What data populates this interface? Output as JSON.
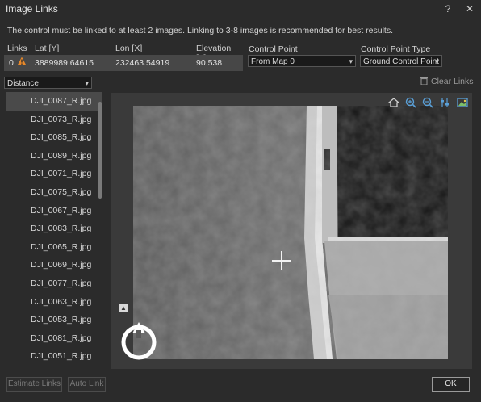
{
  "window": {
    "title": "Image Links"
  },
  "info_text": "The control must be linked to at least 2 images. Linking to 3-8 images is recommended for best results.",
  "links_table": {
    "headers": {
      "links": "Links",
      "lat": "Lat [Y]",
      "lon": "Lon [X]",
      "elev": "Elevation [Z]"
    },
    "row": {
      "links": "0",
      "lat": "3889989.64615",
      "lon": "232463.54919",
      "elev": "90.538"
    }
  },
  "control_point": {
    "label": "Control Point",
    "value": "From Map 0"
  },
  "control_point_type": {
    "label": "Control Point Type",
    "value": "Ground Control Point"
  },
  "sort_by": {
    "value": "Distance"
  },
  "clear_links_label": "Clear Links",
  "images": [
    "DJI_0087_R.jpg",
    "DJI_0073_R.jpg",
    "DJI_0085_R.jpg",
    "DJI_0089_R.jpg",
    "DJI_0071_R.jpg",
    "DJI_0075_R.jpg",
    "DJI_0067_R.jpg",
    "DJI_0083_R.jpg",
    "DJI_0065_R.jpg",
    "DJI_0069_R.jpg",
    "DJI_0077_R.jpg",
    "DJI_0063_R.jpg",
    "DJI_0053_R.jpg",
    "DJI_0081_R.jpg",
    "DJI_0051_R.jpg"
  ],
  "selected_image_index": 0,
  "buttons": {
    "estimate": "Estimate Links",
    "auto": "Auto Link",
    "ok": "OK"
  },
  "icons": {
    "warning": "warning-triangle-icon",
    "trash": "trash-icon",
    "home": "home-icon",
    "zoom_in": "zoom-in-icon",
    "zoom_out": "zoom-out-icon",
    "adjust": "adjust-icon",
    "image": "image-icon",
    "compass": "compass-icon"
  },
  "colors": {
    "warning": "#e8892b",
    "accent_blue": "#5aa0d8"
  }
}
